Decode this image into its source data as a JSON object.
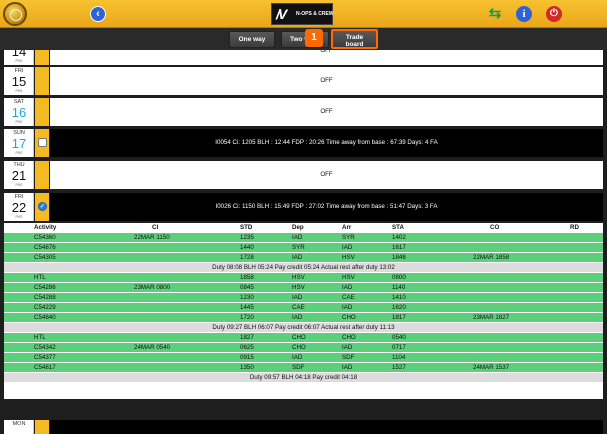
{
  "topbar": {
    "back_icon": "‹",
    "brand_mark": "/V",
    "brand_text": "N-OPS & CREW",
    "info_icon": "i",
    "power_icon": "⏻",
    "swap_icon": "⇆"
  },
  "tabs": {
    "one_way": "One way",
    "two_way": "Two w",
    "trade_board": "Trade\nboard"
  },
  "callout": "1",
  "days": [
    {
      "dow": "",
      "num": "14",
      "blue": false,
      "body": "OFF",
      "style": "white",
      "check": "none"
    },
    {
      "dow": "FRI",
      "num": "15",
      "blue": false,
      "body": "OFF",
      "style": "white",
      "check": "none"
    },
    {
      "dow": "SAT",
      "num": "16",
      "blue": true,
      "body": "OFF",
      "style": "white",
      "check": "none"
    },
    {
      "dow": "SUN",
      "num": "17",
      "blue": true,
      "body": "I0054 Ci: 1205 BLH : 12:44 FDP : 20:26 Time away from base : 67:39 Days: 4 FA",
      "style": "black",
      "check": "off"
    },
    {
      "dow": "THU",
      "num": "21",
      "blue": false,
      "body": "OFF",
      "style": "white",
      "check": "none"
    },
    {
      "dow": "FRI",
      "num": "22",
      "blue": false,
      "body": "I0026 Ci: 1150 BLH : 15:49 FDP : 27:02 Time away from base : 51:47 Days: 3 FA",
      "style": "black",
      "check": "on"
    }
  ],
  "pks": "PKS",
  "table": {
    "headers": {
      "activity": "Activity",
      "ci": "CI",
      "std": "STD",
      "dep": "Dep",
      "arr": "Arr",
      "sta": "STA",
      "co": "CO",
      "rd": "RD"
    },
    "rows": [
      {
        "type": "green",
        "activity": "C54360",
        "ci": "22MAR 1150",
        "std": "1235",
        "dep": "IAD",
        "arr": "SYR",
        "sta": "1402",
        "co": ""
      },
      {
        "type": "green",
        "activity": "C54876",
        "ci": "",
        "std": "1440",
        "dep": "SYR",
        "arr": "IAD",
        "sta": "1617",
        "co": ""
      },
      {
        "type": "green",
        "activity": "C54305",
        "ci": "",
        "std": "1728",
        "dep": "IAD",
        "arr": "HSV",
        "sta": "1848",
        "co": "22MAR 1858"
      },
      {
        "type": "sum",
        "text": "Duty 08:08 BLH 05:24 Pay credit 05:24 Actual rest after duty 13:02"
      },
      {
        "type": "green",
        "activity": "HTL",
        "ci": "",
        "std": "1858",
        "dep": "HSV",
        "arr": "HSV",
        "sta": "0800",
        "co": ""
      },
      {
        "type": "green",
        "activity": "C54286",
        "ci": "23MAR 0800",
        "std": "0845",
        "dep": "HSV",
        "arr": "IAD",
        "sta": "1140",
        "co": ""
      },
      {
        "type": "green",
        "activity": "C54288",
        "ci": "",
        "std": "1230",
        "dep": "IAD",
        "arr": "CAE",
        "sta": "1410",
        "co": ""
      },
      {
        "type": "green",
        "activity": "C54229",
        "ci": "",
        "std": "1445",
        "dep": "CAE",
        "arr": "IAD",
        "sta": "1620",
        "co": ""
      },
      {
        "type": "green",
        "activity": "C54840",
        "ci": "",
        "std": "1720",
        "dep": "IAD",
        "arr": "CHO",
        "sta": "1817",
        "co": "23MAR 1827"
      },
      {
        "type": "sum",
        "text": "Duty 09:27 BLH 06:07 Pay credit 06:07 Actual rest after duty 11:13"
      },
      {
        "type": "green",
        "activity": "HTL",
        "ci": "",
        "std": "1827",
        "dep": "CHO",
        "arr": "CHO",
        "sta": "0540",
        "co": ""
      },
      {
        "type": "green",
        "activity": "C54342",
        "ci": "24MAR 0540",
        "std": "0625",
        "dep": "CHO",
        "arr": "IAD",
        "sta": "0717",
        "co": ""
      },
      {
        "type": "green",
        "activity": "C54377",
        "ci": "",
        "std": "0915",
        "dep": "IAD",
        "arr": "SDF",
        "sta": "1104",
        "co": ""
      },
      {
        "type": "green",
        "activity": "C54817",
        "ci": "",
        "std": "1350",
        "dep": "SDF",
        "arr": "IAD",
        "sta": "1527",
        "co": "24MAR 1537"
      },
      {
        "type": "sum",
        "text": "Duty 09:57 BLH 04:18 Pay credit 04:18"
      }
    ]
  },
  "mon": {
    "dow": "MON"
  }
}
